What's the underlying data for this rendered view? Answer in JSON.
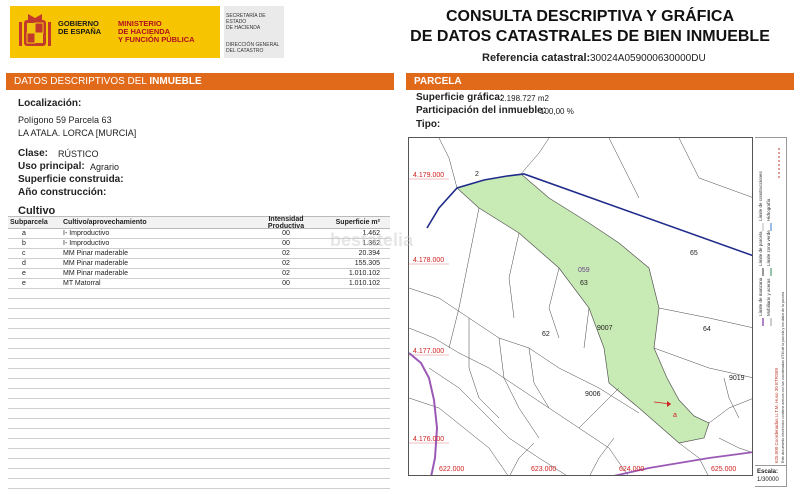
{
  "header": {
    "gov_lines": [
      "GOBIERNO",
      "DE ESPAÑA"
    ],
    "min_lines": [
      "MINISTERIO",
      "DE HACIENDA",
      "Y FUNCIÓN PÚBLICA"
    ],
    "sec_lines": [
      "SECRETARÍA DE ESTADO",
      "DE HACIENDA"
    ],
    "dir_lines": [
      "DIRECCIÓN GENERAL",
      "DEL CATASTRO"
    ],
    "title_line1": "CONSULTA DESCRIPTIVA Y GRÁFICA",
    "title_line2": "DE DATOS CATASTRALES DE BIEN INMUEBLE",
    "ref_label": "Referencia catastral:",
    "ref_value": "30024A059000630000DU",
    "colors": {
      "accent": "#e06a1a",
      "gov_yellow": "#f6c400",
      "min_red": "#b01020"
    }
  },
  "left": {
    "section_prefix": "DATOS DESCRIPTIVOS DEL ",
    "section_bold": "INMUEBLE",
    "localizacion_label": "Localización:",
    "localizacion_line1": "Polígono 59 Parcela 63",
    "localizacion_line2": "LA ATALA. LORCA [MURCIA]",
    "clase_label": "Clase:",
    "clase_value": "RÚSTICO",
    "uso_label": "Uso principal:",
    "uso_value": "Agrario",
    "superficie_label": "Superficie construida:",
    "anio_label": "Año construcción:",
    "cultivo_title": "Cultivo",
    "table": {
      "headers": [
        "Subparcela",
        "Cultivo/aprovechamiento",
        "Intensidad Productiva",
        "Superficie m²"
      ],
      "rows": [
        [
          "a",
          "I- Improductivo",
          "00",
          "1.462"
        ],
        [
          "b",
          "I- Improductivo",
          "00",
          "1.362"
        ],
        [
          "c",
          "MM Pinar maderable",
          "02",
          "20.394"
        ],
        [
          "d",
          "MM Pinar maderable",
          "02",
          "155.305"
        ],
        [
          "e",
          "MM Pinar maderable",
          "02",
          "1.010.102"
        ],
        [
          "e",
          "MT Matorral",
          "00",
          "1.010.102"
        ]
      ]
    }
  },
  "right": {
    "section_title": "PARCELA",
    "sup_grafica_label": "Superficie gráfica:",
    "sup_grafica_value": "2.198.727 m2",
    "participacion_label": "Participación del inmueble:",
    "participacion_value": "100,00 %",
    "tipo_label": "Tipo:",
    "map": {
      "coords_y": [
        "4.179.000",
        "4.178.000",
        "4.177.000",
        "4.176.000"
      ],
      "coords_x": [
        "622.000",
        "623.000",
        "624.000",
        "625.000"
      ],
      "parcel_labels": [
        "2",
        "65",
        "059",
        "63",
        "64",
        "62",
        "9007",
        "9006",
        "9019",
        "a"
      ],
      "watermark": "bestatelia"
    },
    "legend": {
      "items": [
        "Límite de manzana",
        "Límite de parcela",
        "Límite de construcciones",
        "Mobiliario y aceras",
        "Límite zona verde",
        "Hidrografía"
      ],
      "note1": "Este documento electrónico contiene anexos con las coordenadas UTM de la parcela y los datos de la parcela",
      "note2": "625.000 Coordenadas U.T.M. Huso 30 ETRS89"
    },
    "scale_label": "Escala:",
    "scale_value": "1/30000"
  }
}
